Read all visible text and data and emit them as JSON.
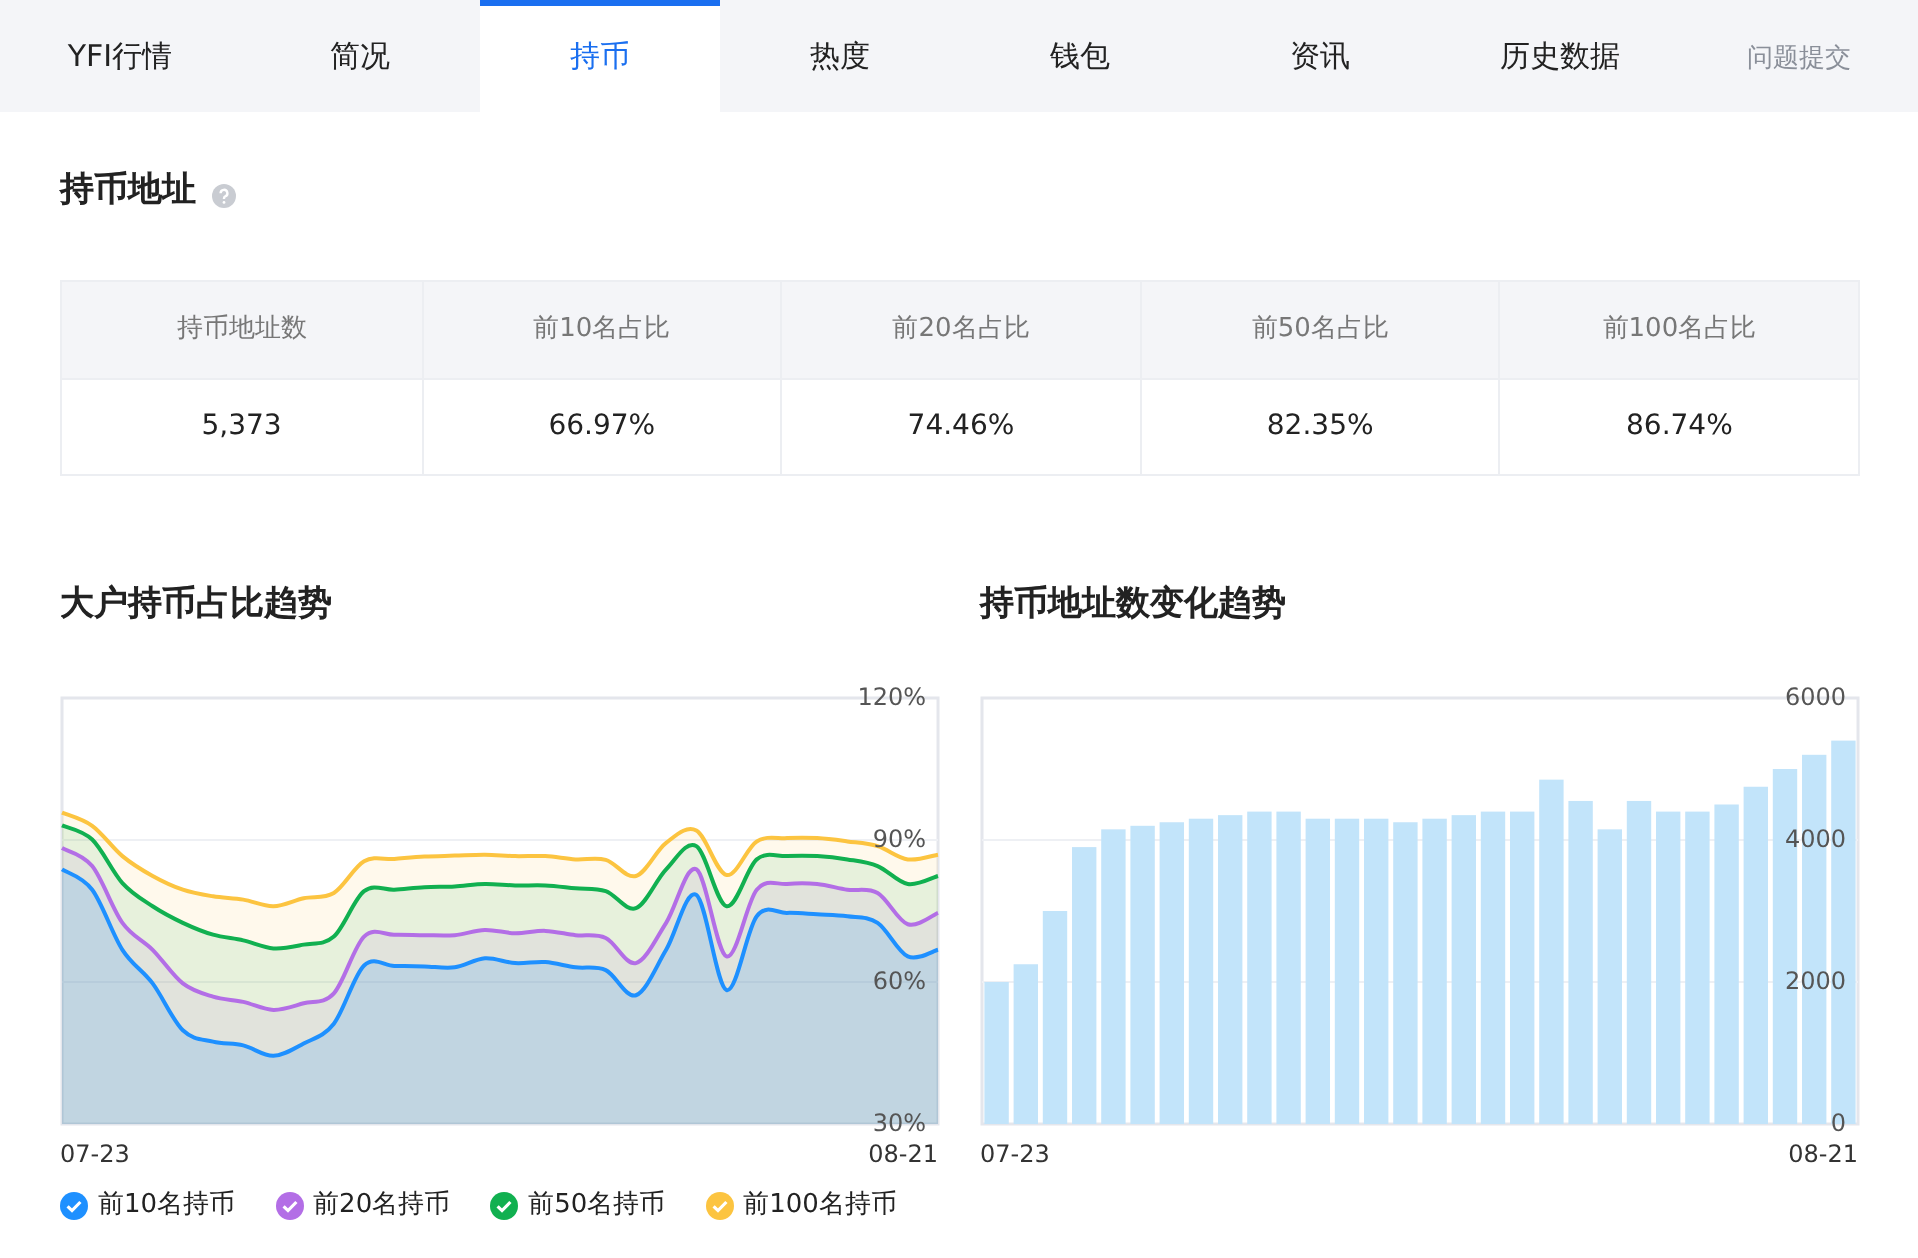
{
  "tabs": [
    {
      "label": "YFI行情",
      "selected": false
    },
    {
      "label": "简况",
      "selected": false
    },
    {
      "label": "持币",
      "selected": true
    },
    {
      "label": "热度",
      "selected": false
    },
    {
      "label": "钱包",
      "selected": false
    },
    {
      "label": "资讯",
      "selected": false
    },
    {
      "label": "历史数据",
      "selected": false
    }
  ],
  "feedback_link": "问题提交",
  "section_title": "持币地址",
  "table": {
    "columns": [
      "持币地址数",
      "前10名占比",
      "前20名占比",
      "前50名占比",
      "前100名占比"
    ],
    "rows": [
      [
        "5,373",
        "66.97%",
        "74.46%",
        "82.35%",
        "86.74%"
      ]
    ]
  },
  "charts": [
    {
      "title": "大户持币占比趋势",
      "x_axis_labels": [
        "07-23",
        "08-21"
      ],
      "chart_data": {
        "type": "area",
        "ylim": [
          30,
          120
        ],
        "yticks": [
          {
            "value": 120,
            "label": "120%"
          },
          {
            "value": 90,
            "label": "90%"
          },
          {
            "value": 60,
            "label": "60%"
          },
          {
            "value": 30,
            "label": "30%"
          }
        ],
        "series": [
          {
            "name": "前10名持币",
            "color": "#1e90ff",
            "values": [
              83.8,
              79.5,
              66.8,
              59.7,
              49.8,
              47.4,
              46.6,
              44.4,
              47,
              51.2,
              63.5,
              63.4,
              63.3,
              63.1,
              65,
              64,
              64.2,
              63.1,
              62.5,
              57.2,
              66.8,
              78.4,
              58.3,
              73.9,
              74.6,
              74.3,
              73.9,
              72.5,
              65.4,
              66.8
            ]
          },
          {
            "name": "前20名持币",
            "color": "#b36ee6",
            "values": [
              88.3,
              84.5,
              72.5,
              66.8,
              59.7,
              56.9,
              55.8,
              54.1,
              55.5,
              57.6,
              69.6,
              70,
              69.9,
              69.9,
              71,
              70.3,
              70.8,
              69.9,
              69.3,
              64,
              72.5,
              83.8,
              65.4,
              79.5,
              80.7,
              80.7,
              79.5,
              78.8,
              72.2,
              74.6
            ]
          },
          {
            "name": "前50名持币",
            "color": "#11b050",
            "values": [
              93.1,
              90.1,
              80.9,
              76,
              72.5,
              70,
              68.8,
              67.1,
              67.9,
              69.6,
              79.2,
              79.5,
              80,
              80.2,
              80.7,
              80.4,
              80.4,
              79.8,
              79.2,
              75.6,
              83.8,
              88.7,
              76,
              85.9,
              86.6,
              86.6,
              85.9,
              84.5,
              80.7,
              82.4
            ]
          },
          {
            "name": "前100名持币",
            "color": "#fcc440",
            "values": [
              95.8,
              93,
              86.6,
              82.4,
              79.5,
              78.1,
              77.4,
              76,
              77.7,
              78.8,
              85.5,
              86,
              86.5,
              86.7,
              86.9,
              86.6,
              86.6,
              85.9,
              85.8,
              82.4,
              89.4,
              92,
              82.6,
              89.7,
              90.4,
              90.4,
              89.7,
              88.7,
              85.9,
              86.9
            ]
          }
        ]
      }
    },
    {
      "title": "持币地址数变化趋势",
      "x_axis_labels": [
        "07-23",
        "08-21"
      ],
      "chart_data": {
        "type": "bar",
        "ylim": [
          0,
          6000
        ],
        "yticks": [
          6000,
          4000,
          2000,
          0
        ],
        "series": [
          {
            "color": "#c2e4fa",
            "values": [
              2000,
              2250,
              3000,
              3900,
              4150,
              4200,
              4250,
              4300,
              4350,
              4400,
              4400,
              4300,
              4300,
              4300,
              4250,
              4300,
              4350,
              4400,
              4400,
              4850,
              4550,
              4150,
              4550,
              4400,
              4400,
              4500,
              4750,
              5000,
              5200,
              5400
            ]
          }
        ]
      }
    }
  ]
}
